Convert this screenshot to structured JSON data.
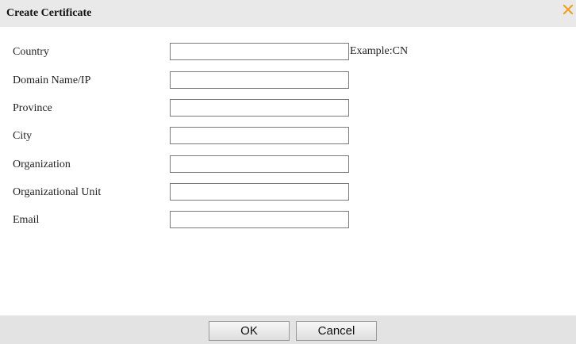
{
  "dialog": {
    "title": "Create Certificate",
    "close_icon": "close-icon",
    "accent_color": "#f0a020"
  },
  "fields": [
    {
      "label": "Country",
      "value": "",
      "hint": "Example:CN"
    },
    {
      "label": "Domain Name/IP",
      "value": ""
    },
    {
      "label": "Province",
      "value": ""
    },
    {
      "label": "City",
      "value": ""
    },
    {
      "label": "Organization",
      "value": ""
    },
    {
      "label": "Organizational Unit",
      "value": ""
    },
    {
      "label": "Email",
      "value": ""
    }
  ],
  "footer": {
    "ok_label": "OK",
    "cancel_label": "Cancel"
  }
}
